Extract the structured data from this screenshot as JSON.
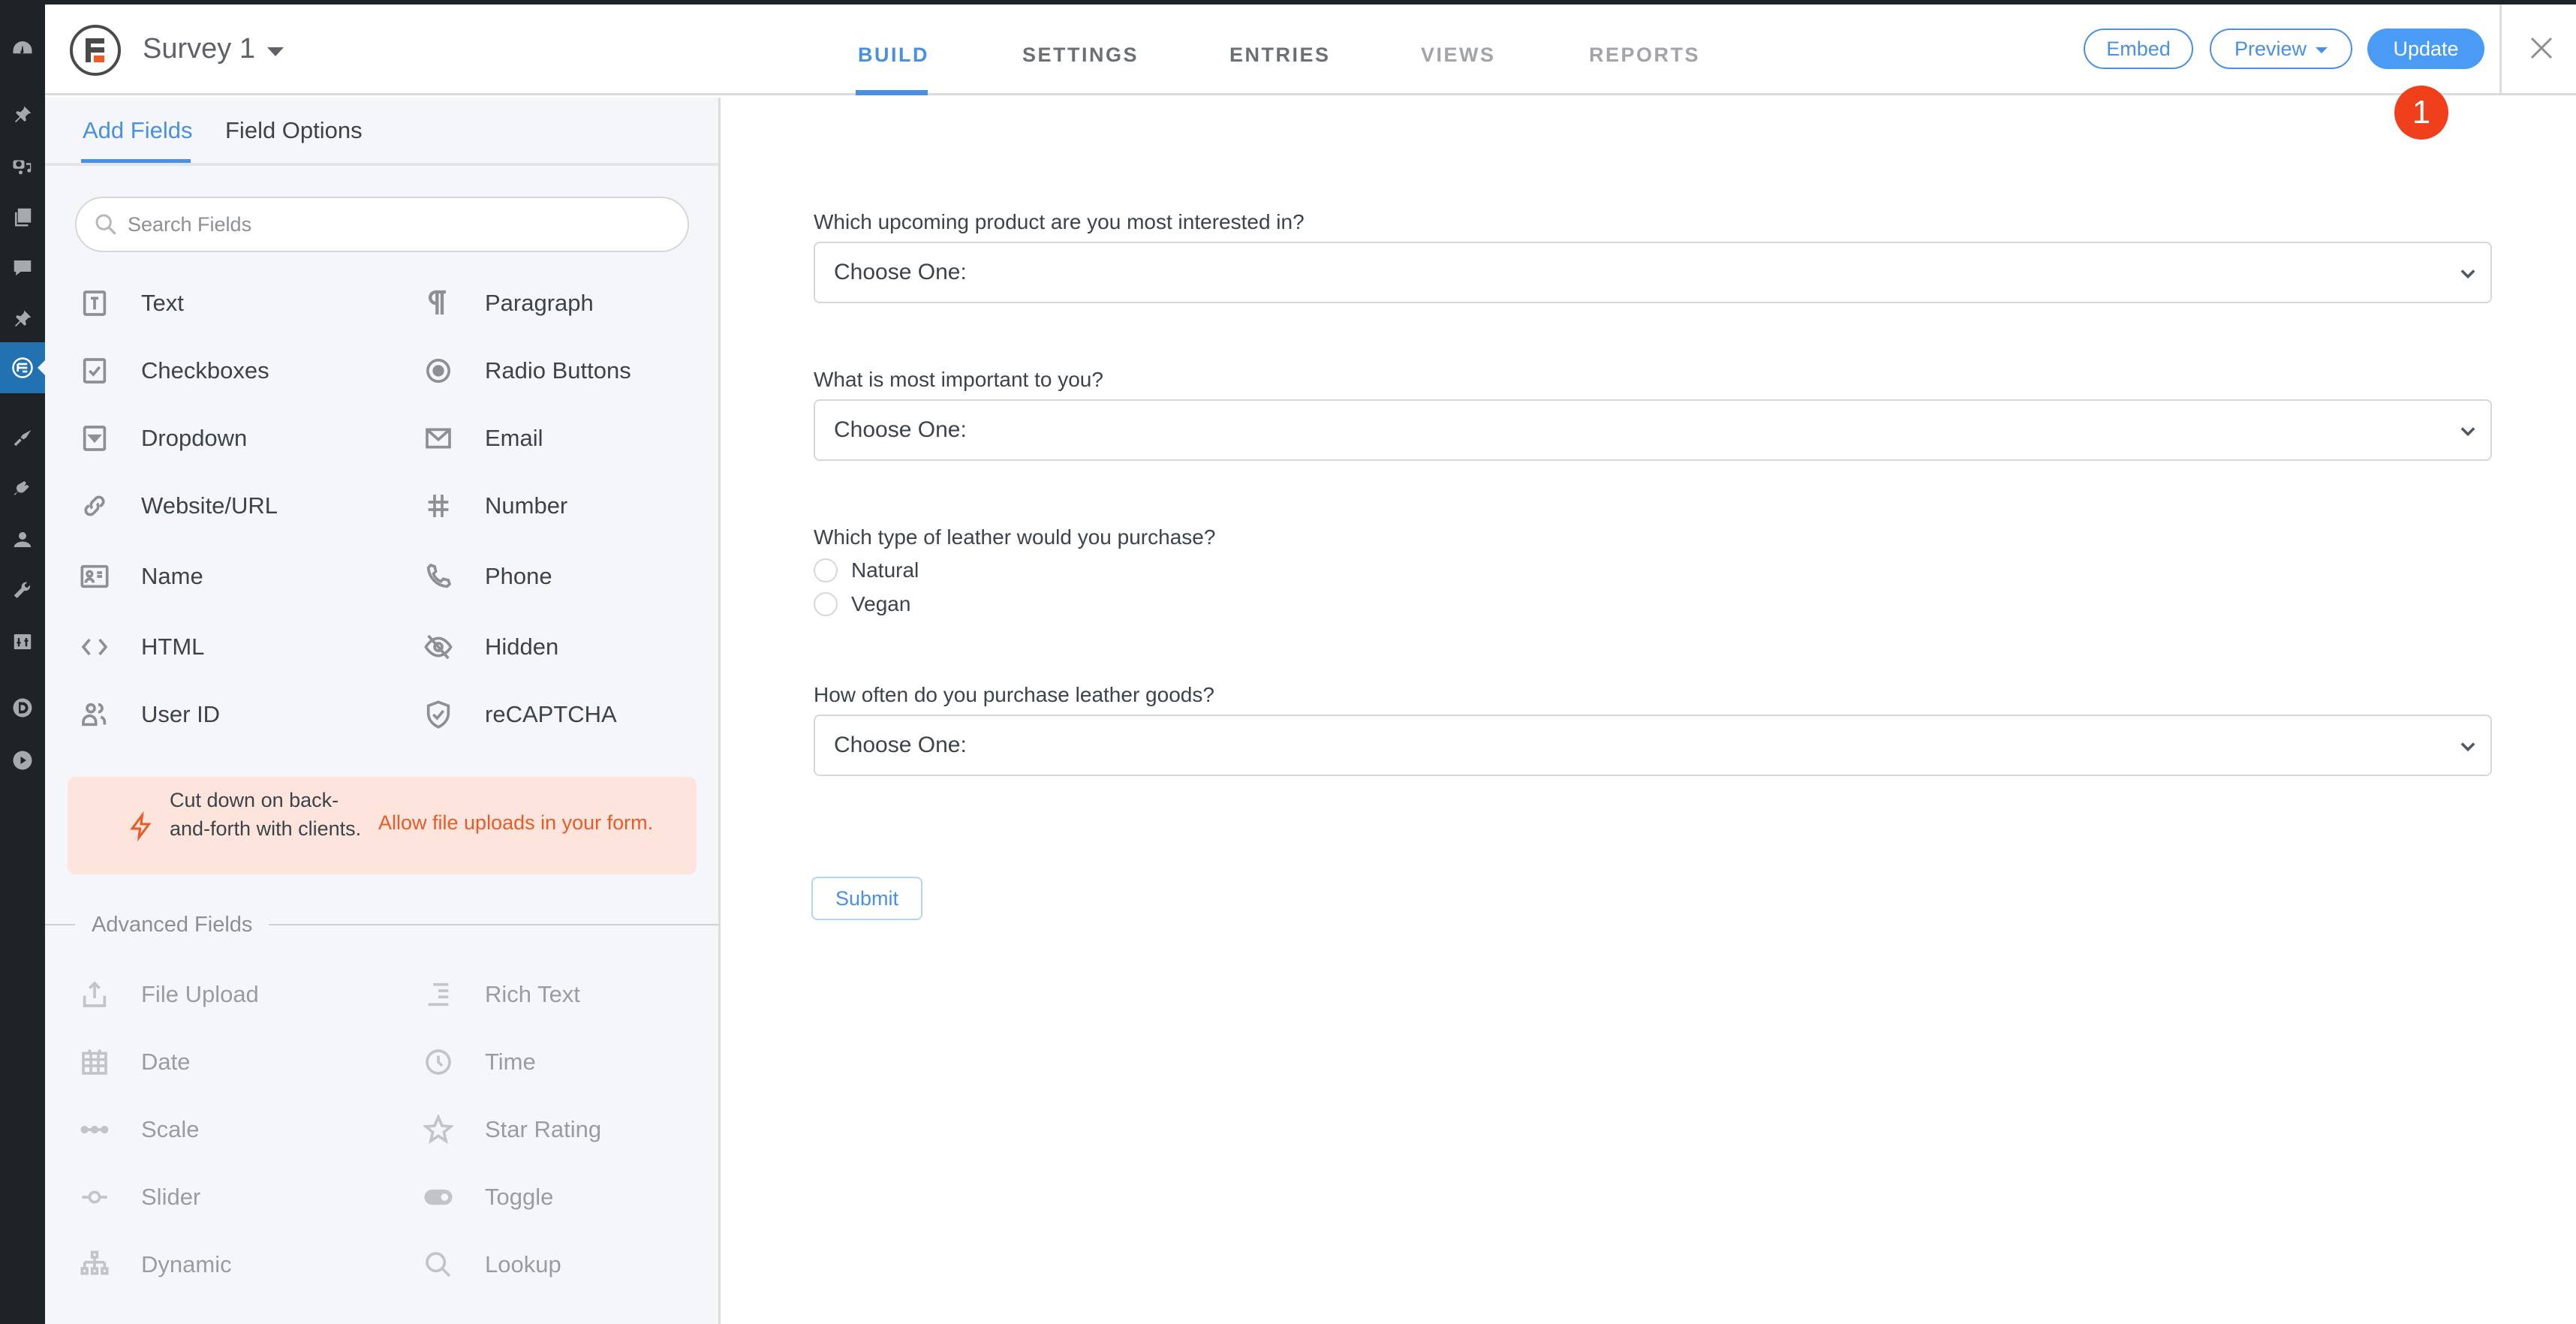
{
  "header": {
    "form_title": "Survey 1",
    "tabs": [
      {
        "label": "BUILD",
        "state": "active"
      },
      {
        "label": "SETTINGS",
        "state": "normal"
      },
      {
        "label": "ENTRIES",
        "state": "normal"
      },
      {
        "label": "VIEWS",
        "state": "disabled"
      },
      {
        "label": "REPORTS",
        "state": "disabled"
      }
    ],
    "embed_label": "Embed",
    "preview_label": "Preview",
    "update_label": "Update",
    "step_badge": "1"
  },
  "admin_sidebar": {
    "icons": [
      "dashboard-icon",
      "pin-icon",
      "media-icon",
      "pages-icon",
      "comments-icon",
      "pin-icon",
      "formidable-icon",
      "appearance-icon",
      "plugins-icon",
      "users-icon",
      "tools-icon",
      "settings-icon",
      "divi-icon",
      "play-icon"
    ],
    "active": "formidable-icon"
  },
  "panel": {
    "tabs": [
      {
        "label": "Add Fields",
        "active": true
      },
      {
        "label": "Field Options",
        "active": false
      }
    ],
    "search_placeholder": "Search Fields",
    "fields": [
      {
        "label": "Text",
        "icon": "text-icon"
      },
      {
        "label": "Paragraph",
        "icon": "paragraph-icon"
      },
      {
        "label": "Checkboxes",
        "icon": "checkbox-icon"
      },
      {
        "label": "Radio Buttons",
        "icon": "radio-icon"
      },
      {
        "label": "Dropdown",
        "icon": "dropdown-icon"
      },
      {
        "label": "Email",
        "icon": "email-icon"
      },
      {
        "label": "Website/URL",
        "icon": "link-icon"
      },
      {
        "label": "Number",
        "icon": "hash-icon"
      },
      {
        "label": "Name",
        "icon": "id-card-icon"
      },
      {
        "label": "Phone",
        "icon": "phone-icon"
      },
      {
        "label": "HTML",
        "icon": "code-icon"
      },
      {
        "label": "Hidden",
        "icon": "eye-off-icon"
      },
      {
        "label": "User ID",
        "icon": "users-icon"
      },
      {
        "label": "reCAPTCHA",
        "icon": "shield-check-icon"
      }
    ],
    "promo": {
      "text": "Cut down on back-and-forth with clients.",
      "link": "Allow file uploads in your form."
    },
    "advanced_title": "Advanced Fields",
    "advanced_fields": [
      {
        "label": "File Upload",
        "icon": "upload-icon"
      },
      {
        "label": "Rich Text",
        "icon": "rich-text-icon"
      },
      {
        "label": "Date",
        "icon": "calendar-icon"
      },
      {
        "label": "Time",
        "icon": "clock-icon"
      },
      {
        "label": "Scale",
        "icon": "scale-icon"
      },
      {
        "label": "Star Rating",
        "icon": "star-icon"
      },
      {
        "label": "Slider",
        "icon": "slider-icon"
      },
      {
        "label": "Toggle",
        "icon": "toggle-icon"
      },
      {
        "label": "Dynamic",
        "icon": "hierarchy-icon"
      },
      {
        "label": "Lookup",
        "icon": "search-icon"
      }
    ]
  },
  "form": {
    "questions": [
      {
        "label": "Which upcoming product are you most interested in?",
        "type": "select",
        "value": "Choose One:"
      },
      {
        "label": "What is most important to you?",
        "type": "select",
        "value": "Choose One:"
      },
      {
        "label": "Which type of leather would you purchase?",
        "type": "radio",
        "options": [
          "Natural",
          "Vegan"
        ]
      },
      {
        "label": "How often do you purchase leather goods?",
        "type": "select",
        "value": "Choose One:"
      }
    ],
    "submit_label": "Submit"
  },
  "colors": {
    "accent": "#4a90e2",
    "update_button": "#4a9bf5",
    "badge": "#f0401b",
    "promo_bg": "#fde5dd",
    "promo_link": "#e85b27",
    "admin_bg": "#1d2327",
    "admin_active": "#2271b1"
  }
}
